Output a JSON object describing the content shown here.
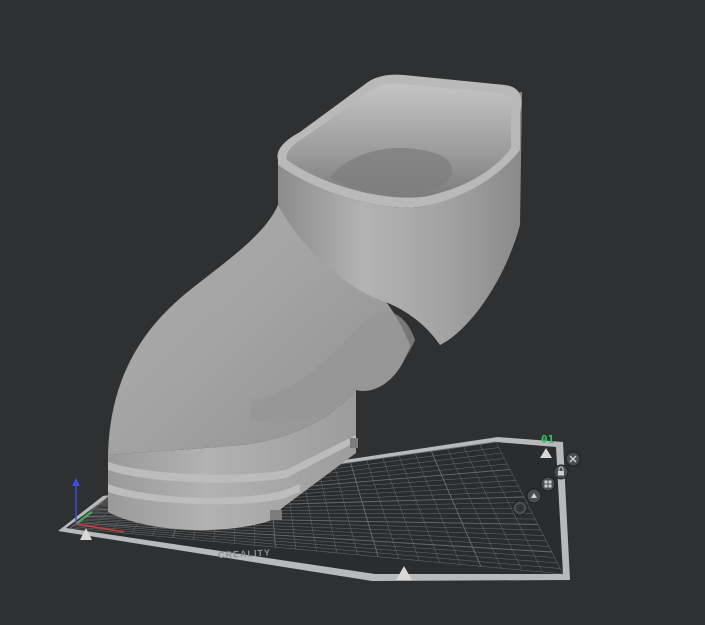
{
  "viewport": {
    "background": "#2f3031"
  },
  "build_plate": {
    "brand": "CREALITY",
    "plate_number": "01",
    "colors": {
      "surface": "#2b2c2d",
      "grid": "#6b6c6e",
      "border": "#b8b9ba",
      "plate_number": "#35c86a"
    }
  },
  "plate_controls": [
    {
      "icon": "close-icon"
    },
    {
      "icon": "lock-icon"
    },
    {
      "icon": "arrange-icon"
    },
    {
      "icon": "orient-icon"
    },
    {
      "icon": "settings-icon"
    }
  ],
  "model": {
    "color": "#a6a6a6"
  },
  "axes": {
    "x_color": "#d63a3a",
    "y_color": "#3fbf4a",
    "z_color": "#3a4ee0"
  }
}
